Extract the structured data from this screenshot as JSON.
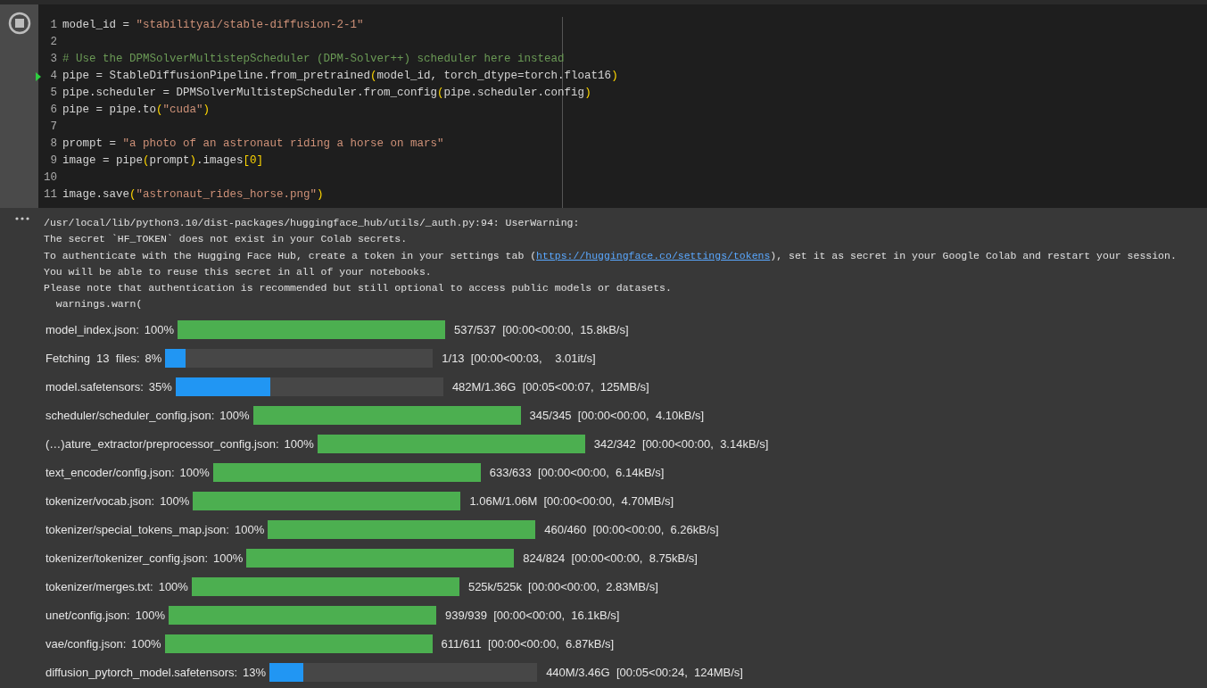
{
  "code_cell": {
    "running": true,
    "lines": [
      {
        "number": "1",
        "current": false,
        "tokens": [
          {
            "kind": "plain",
            "text": "model_id = "
          },
          {
            "kind": "string",
            "text": "\"stabilityai/stable-diffusion-2-1\""
          }
        ]
      },
      {
        "number": "2",
        "current": false
      },
      {
        "number": "3",
        "current": false,
        "tokens": [
          {
            "kind": "comment",
            "text": "# Use the DPMSolverMultistepScheduler (DPM-Solver++) scheduler here instead"
          }
        ]
      },
      {
        "number": "4",
        "current": true,
        "tokens": [
          {
            "kind": "plain",
            "text": "pipe = StableDiffusionPipeline.from_pretrained"
          },
          {
            "kind": "bracket",
            "text": "("
          },
          {
            "kind": "plain",
            "text": "model_id, torch_dtype=torch.float16"
          },
          {
            "kind": "bracket",
            "text": ")"
          }
        ]
      },
      {
        "number": "5",
        "current": false,
        "tokens": [
          {
            "kind": "plain",
            "text": "pipe.scheduler = DPMSolverMultistepScheduler.from_config"
          },
          {
            "kind": "bracket",
            "text": "("
          },
          {
            "kind": "plain",
            "text": "pipe.scheduler.config"
          },
          {
            "kind": "bracket",
            "text": ")"
          }
        ]
      },
      {
        "number": "6",
        "current": false,
        "tokens": [
          {
            "kind": "plain",
            "text": "pipe = pipe.to"
          },
          {
            "kind": "bracket",
            "text": "("
          },
          {
            "kind": "string",
            "text": "\"cuda\""
          },
          {
            "kind": "bracket",
            "text": ")"
          }
        ]
      },
      {
        "number": "7",
        "current": false
      },
      {
        "number": "8",
        "current": false,
        "tokens": [
          {
            "kind": "plain",
            "text": "prompt = "
          },
          {
            "kind": "string",
            "text": "\"a photo of an astronaut riding a horse on mars\""
          }
        ]
      },
      {
        "number": "9",
        "current": false,
        "tokens": [
          {
            "kind": "plain",
            "text": "image = pipe"
          },
          {
            "kind": "bracket",
            "text": "("
          },
          {
            "kind": "plain",
            "text": "prompt"
          },
          {
            "kind": "bracket",
            "text": ")"
          },
          {
            "kind": "plain",
            "text": ".images"
          },
          {
            "kind": "bracket",
            "text": "[0]"
          }
        ]
      },
      {
        "number": "10",
        "current": false
      },
      {
        "number": "11",
        "current": false,
        "tokens": [
          {
            "kind": "plain",
            "text": "image.save"
          },
          {
            "kind": "bracket",
            "text": "("
          },
          {
            "kind": "string",
            "text": "\"astronaut_rides_horse.png\""
          },
          {
            "kind": "bracket",
            "text": ")"
          }
        ]
      }
    ]
  },
  "output": {
    "text_lines": [
      {
        "parts": [
          {
            "kind": "text",
            "text": "/usr/local/lib/python3.10/dist-packages/huggingface_hub/utils/_auth.py:94: UserWarning:"
          }
        ]
      },
      {
        "parts": [
          {
            "kind": "text",
            "text": "The secret `HF_TOKEN` does not exist in your Colab secrets."
          }
        ]
      },
      {
        "parts": [
          {
            "kind": "text",
            "text": "To authenticate with the Hugging Face Hub, create a token in your settings tab ("
          },
          {
            "kind": "link",
            "text": "https://huggingface.co/settings/tokens"
          },
          {
            "kind": "text",
            "text": "), set it as secret in your Google Colab and restart your session."
          }
        ]
      },
      {
        "parts": [
          {
            "kind": "text",
            "text": "You will be able to reuse this secret in all of your notebooks."
          }
        ]
      },
      {
        "parts": [
          {
            "kind": "text",
            "text": "Please note that authentication is recommended but still optional to access public models or datasets."
          }
        ]
      },
      {
        "parts": [
          {
            "kind": "text",
            "text": "  warnings.warn("
          }
        ]
      }
    ],
    "progress": [
      {
        "label": "model_index.json:",
        "percent": "100%",
        "level": 1,
        "complete": true,
        "stats": "537/537  [00:00<00:00,  15.8kB/s]"
      },
      {
        "label": "Fetching  13  files:",
        "percent": "8%",
        "level": 0.077,
        "complete": false,
        "stats": "1/13  [00:00<00:03,    3.01it/s]"
      },
      {
        "label": "model.safetensors:",
        "percent": "35%",
        "level": 0.354,
        "complete": false,
        "stats": "482M/1.36G  [00:05<00:07,  125MB/s]"
      },
      {
        "label": "scheduler/scheduler_config.json:",
        "percent": "100%",
        "level": 1,
        "complete": true,
        "stats": "345/345  [00:00<00:00,  4.10kB/s]"
      },
      {
        "label": "(…)ature_extractor/preprocessor_config.json:",
        "percent": "100%",
        "level": 1,
        "complete": true,
        "stats": "342/342  [00:00<00:00,  3.14kB/s]"
      },
      {
        "label": "text_encoder/config.json:",
        "percent": "100%",
        "level": 1,
        "complete": true,
        "stats": "633/633  [00:00<00:00,  6.14kB/s]"
      },
      {
        "label": "tokenizer/vocab.json:",
        "percent": "100%",
        "level": 1,
        "complete": true,
        "stats": "1.06M/1.06M  [00:00<00:00,  4.70MB/s]"
      },
      {
        "label": "tokenizer/special_tokens_map.json:",
        "percent": "100%",
        "level": 1,
        "complete": true,
        "stats": "460/460  [00:00<00:00,  6.26kB/s]"
      },
      {
        "label": "tokenizer/tokenizer_config.json:",
        "percent": "100%",
        "level": 1,
        "complete": true,
        "stats": "824/824  [00:00<00:00,  8.75kB/s]"
      },
      {
        "label": "tokenizer/merges.txt:",
        "percent": "100%",
        "level": 1,
        "complete": true,
        "stats": "525k/525k  [00:00<00:00,  2.83MB/s]"
      },
      {
        "label": "unet/config.json:",
        "percent": "100%",
        "level": 1,
        "complete": true,
        "stats": "939/939  [00:00<00:00,  16.1kB/s]"
      },
      {
        "label": "vae/config.json:",
        "percent": "100%",
        "level": 1,
        "complete": true,
        "stats": "611/611  [00:00<00:00,  6.87kB/s]"
      },
      {
        "label": "diffusion_pytorch_model.safetensors:",
        "percent": "13%",
        "level": 0.127,
        "complete": false,
        "stats": "440M/3.46G  [00:05<00:24,  124MB/s]"
      }
    ]
  }
}
